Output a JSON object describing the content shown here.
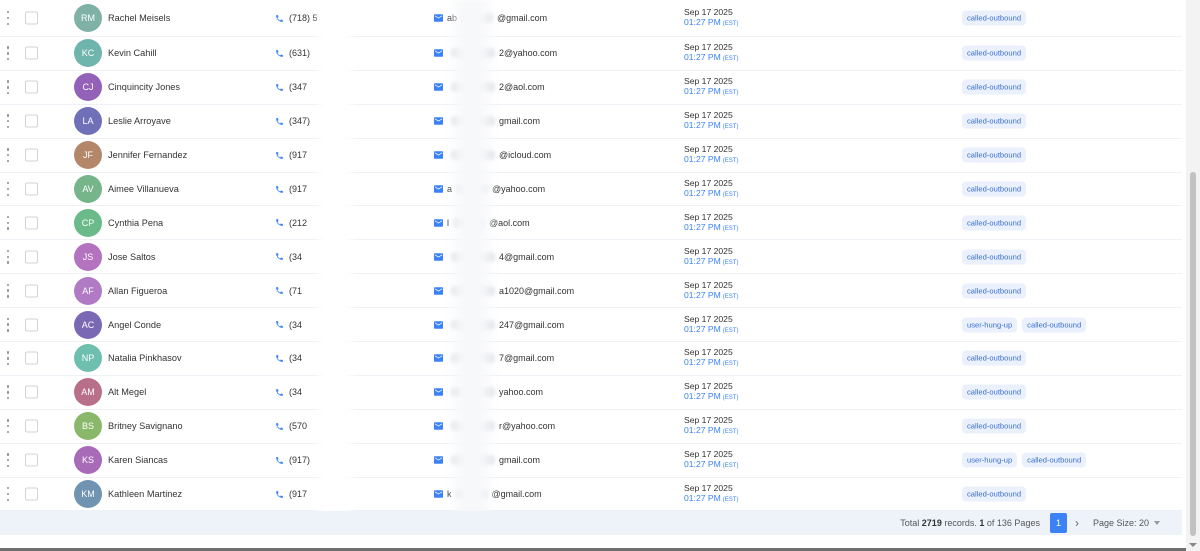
{
  "rows": [
    {
      "initials": "RM",
      "name": "Rachel Meisels",
      "color": "#7fb1a6",
      "phone": "(718) 5",
      "email_prefix": "ab",
      "email_domain": "@gmail.com",
      "date": "Sep 17 2025",
      "time": "01:27 PM",
      "tz": "(EST)",
      "tags": [
        "called-outbound"
      ]
    },
    {
      "initials": "KC",
      "name": "Kevin Cahill",
      "color": "#6fb5ae",
      "phone": "(631)",
      "email_prefix": "",
      "email_domain": "2@yahoo.com",
      "date": "Sep 17 2025",
      "time": "01:27 PM",
      "tz": "(EST)",
      "tags": [
        "called-outbound"
      ]
    },
    {
      "initials": "CJ",
      "name": "Cinquincity Jones",
      "color": "#9362b8",
      "phone": "(347",
      "email_prefix": "",
      "email_domain": "2@aol.com",
      "date": "Sep 17 2025",
      "time": "01:27 PM",
      "tz": "(EST)",
      "tags": [
        "called-outbound"
      ]
    },
    {
      "initials": "LA",
      "name": "Leslie Arroyave",
      "color": "#7070b8",
      "phone": "(347)",
      "email_prefix": "",
      "email_domain": "gmail.com",
      "date": "Sep 17 2025",
      "time": "01:27 PM",
      "tz": "(EST)",
      "tags": [
        "called-outbound"
      ]
    },
    {
      "initials": "JF",
      "name": "Jennifer Fernandez",
      "color": "#b5876a",
      "phone": "(917",
      "email_prefix": "",
      "email_domain": "@icloud.com",
      "date": "Sep 17 2025",
      "time": "01:27 PM",
      "tz": "(EST)",
      "tags": [
        "called-outbound"
      ]
    },
    {
      "initials": "AV",
      "name": "Aimee Villanueva",
      "color": "#76b58a",
      "phone": "(917",
      "email_prefix": "a",
      "email_domain": "@yahoo.com",
      "date": "Sep 17 2025",
      "time": "01:27 PM",
      "tz": "(EST)",
      "tags": [
        "called-outbound"
      ]
    },
    {
      "initials": "CP",
      "name": "Cynthia Pena",
      "color": "#6bba8a",
      "phone": "(212",
      "email_prefix": "l",
      "email_domain": "@aol.com",
      "date": "Sep 17 2025",
      "time": "01:27 PM",
      "tz": "(EST)",
      "tags": [
        "called-outbound"
      ]
    },
    {
      "initials": "JS",
      "name": "Jose Saltos",
      "color": "#b373bf",
      "phone": "(34",
      "email_prefix": "",
      "email_domain": "4@gmail.com",
      "date": "Sep 17 2025",
      "time": "01:27 PM",
      "tz": "(EST)",
      "tags": [
        "called-outbound"
      ]
    },
    {
      "initials": "AF",
      "name": "Allan Figueroa",
      "color": "#b07bc4",
      "phone": "(71",
      "email_prefix": "",
      "email_domain": "a1020@gmail.com",
      "date": "Sep 17 2025",
      "time": "01:27 PM",
      "tz": "(EST)",
      "tags": [
        "called-outbound"
      ]
    },
    {
      "initials": "AC",
      "name": "Angel Conde",
      "color": "#7a68b5",
      "phone": "(34",
      "email_prefix": "",
      "email_domain": "247@gmail.com",
      "date": "Sep 17 2025",
      "time": "01:27 PM",
      "tz": "(EST)",
      "tags": [
        "user-hung-up",
        "called-outbound"
      ]
    },
    {
      "initials": "NP",
      "name": "Natalia Pinkhasov",
      "color": "#6fbfae",
      "phone": "(34",
      "email_prefix": "",
      "email_domain": "7@gmail.com",
      "date": "Sep 17 2025",
      "time": "01:27 PM",
      "tz": "(EST)",
      "tags": [
        "called-outbound"
      ]
    },
    {
      "initials": "AM",
      "name": "Alt Megel",
      "color": "#b8708a",
      "phone": "(34",
      "email_prefix": "",
      "email_domain": "yahoo.com",
      "date": "Sep 17 2025",
      "time": "01:27 PM",
      "tz": "(EST)",
      "tags": [
        "called-outbound"
      ]
    },
    {
      "initials": "BS",
      "name": "Britney Savignano",
      "color": "#8ab86a",
      "phone": "(570",
      "email_prefix": "",
      "email_domain": "r@yahoo.com",
      "date": "Sep 17 2025",
      "time": "01:27 PM",
      "tz": "(EST)",
      "tags": [
        "called-outbound"
      ]
    },
    {
      "initials": "KS",
      "name": "Karen Siancas",
      "color": "#a86bb8",
      "phone": "(917)",
      "email_prefix": "",
      "email_domain": "gmail.com",
      "date": "Sep 17 2025",
      "time": "01:27 PM",
      "tz": "(EST)",
      "tags": [
        "user-hung-up",
        "called-outbound"
      ]
    },
    {
      "initials": "KM",
      "name": "Kathleen Martinez",
      "color": "#6f93b0",
      "phone": "(917",
      "email_prefix": "k",
      "email_domain": "@gmail.com",
      "date": "Sep 17 2025",
      "time": "01:27 PM",
      "tz": "(EST)",
      "tags": [
        "called-outbound"
      ]
    }
  ],
  "pagination": {
    "total_prefix": "Total",
    "total_count": "2719",
    "records_label": "records.",
    "current": "1",
    "of_label": "of 136 Pages",
    "page_button": "1",
    "next_icon": "chevron-right-icon",
    "page_size_label": "Page Size: 20"
  },
  "colors": {
    "accent": "#3b82f6",
    "tag_bg": "#eaf1fc",
    "tag_text": "#3b6fd0",
    "footer_bg": "#eef3fa"
  }
}
